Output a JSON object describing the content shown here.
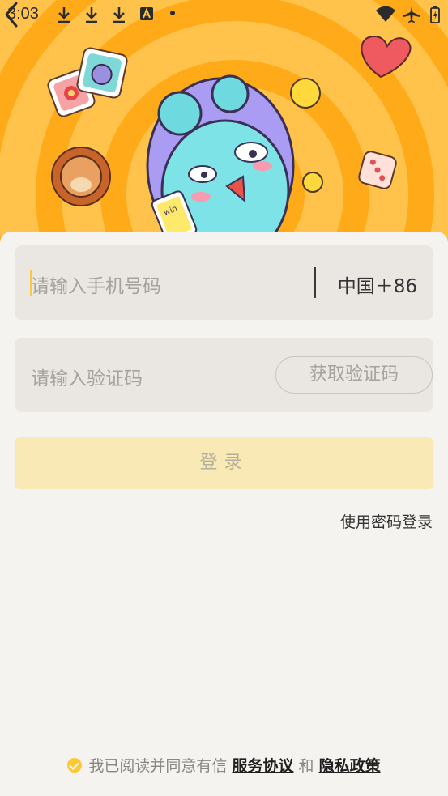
{
  "status_bar": {
    "time": "3:03",
    "icons": [
      "download-icon",
      "download-icon",
      "download-icon",
      "a-icon",
      "dot-icon",
      "wifi-icon",
      "airplane-icon",
      "battery-icon"
    ]
  },
  "hero": {
    "phone_text": "win",
    "colors": {
      "background": "#ffbf3f",
      "rings": "#ffae1a",
      "character": "#7de3e6",
      "helmet": "#a99cf2"
    }
  },
  "form": {
    "phone_placeholder": "请输入手机号码",
    "country_code": "中国＋86",
    "code_placeholder": "请输入验证码",
    "get_code_label": "获取验证码",
    "login_label": "登录",
    "password_login_label": "使用密码登录"
  },
  "agreement": {
    "prefix": "我已阅读并同意有信",
    "service_link": "服务协议",
    "and": "和",
    "privacy_link": "隐私政策"
  },
  "colors": {
    "accent": "#ffc833",
    "login_button": "#f8e9b5",
    "field_bg": "#eae7e2"
  }
}
